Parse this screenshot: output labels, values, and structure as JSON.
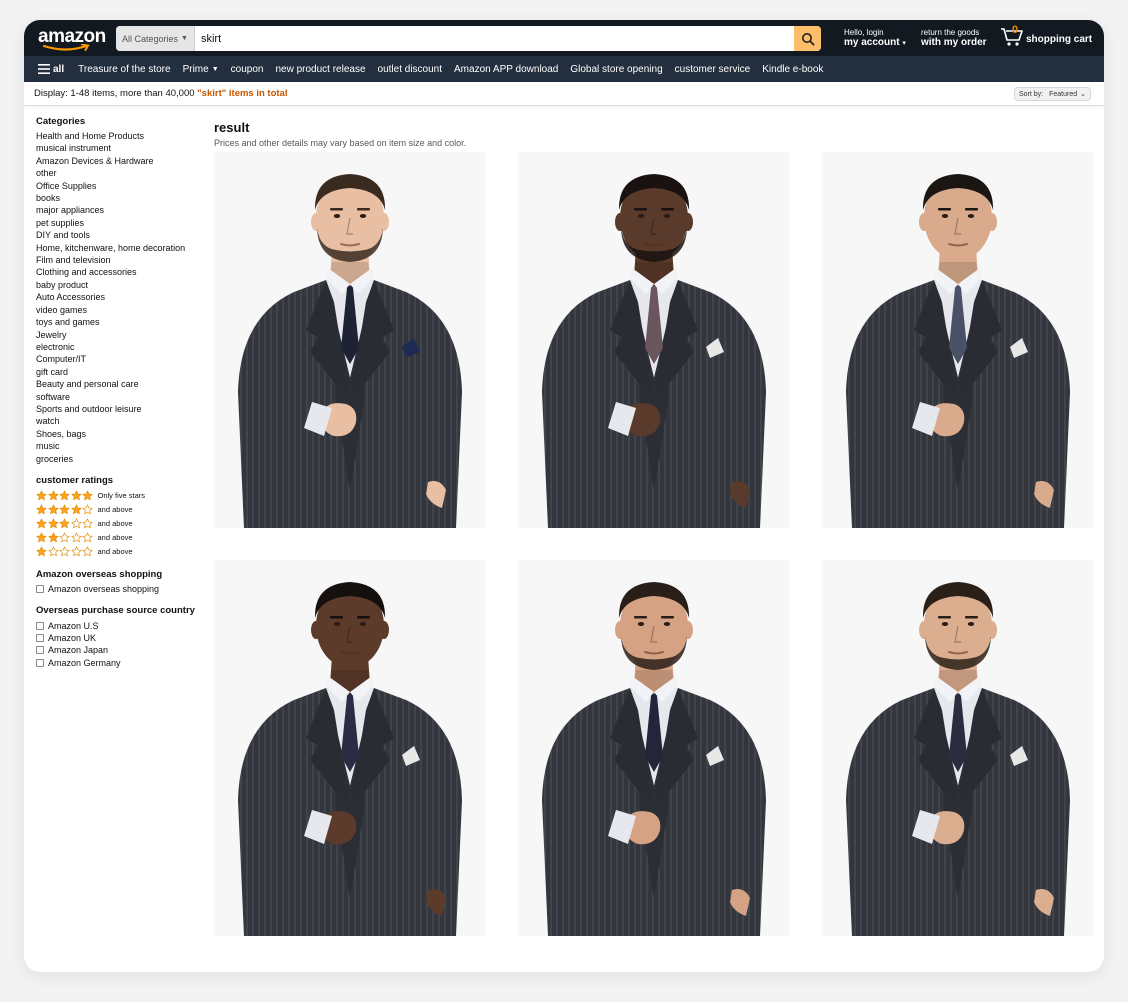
{
  "header": {
    "logo": "amazon",
    "search_category": "All Categories",
    "search_value": "skirt",
    "account_greeting": "Hello, login",
    "account_label": "my account",
    "orders_small": "return the goods",
    "orders_label": "with my order",
    "cart_count": "0",
    "cart_label": "shopping cart"
  },
  "nav": {
    "all": "all",
    "items": [
      "Treasure of the store",
      "Prime",
      "coupon",
      "new product release",
      "outlet discount",
      "Amazon APP download",
      "Global store opening",
      "customer service",
      "Kindle e-book"
    ]
  },
  "results": {
    "prefix": "Display: 1-48 items, more than 40,000 ",
    "query": "\"skirt\" items in total",
    "sort_label": "Sort by:",
    "sort_value": "Featured"
  },
  "sidebar": {
    "categories_title": "Categories",
    "categories": [
      "Health and Home Products",
      "musical instrument",
      "Amazon Devices & Hardware",
      "other",
      "Office Supplies",
      "books",
      "major appliances",
      "pet supplies",
      "DIY and tools",
      "Home, kitchenware, home decoration",
      "Film and television",
      "Clothing and accessories",
      "baby product",
      "Auto Accessories",
      "video games",
      "toys and games",
      "Jewelry",
      "electronic",
      "Computer/IT",
      "gift card",
      "Beauty and personal care",
      "software",
      "Sports and outdoor leisure",
      "watch",
      "Shoes, bags",
      "music",
      "groceries"
    ],
    "ratings_title": "customer ratings",
    "ratings": [
      {
        "stars": 5,
        "label": "Only five stars"
      },
      {
        "stars": 4,
        "label": "and above"
      },
      {
        "stars": 3,
        "label": "and above"
      },
      {
        "stars": 2,
        "label": "and above"
      },
      {
        "stars": 1,
        "label": "and above"
      }
    ],
    "overseas_title": "Amazon overseas shopping",
    "overseas_option": "Amazon overseas shopping",
    "source_title": "Overseas purchase source country",
    "sources": [
      "Amazon U.S",
      "Amazon UK",
      "Amazon Japan",
      "Amazon Germany"
    ]
  },
  "main": {
    "title": "result",
    "subtitle": "Prices and other details may vary based on item size and color.",
    "products": [
      {
        "skin": "#e8bfa3",
        "hair": "#3a2a20",
        "beard": true,
        "tie": "#1e2235",
        "square": "#1f2a55"
      },
      {
        "skin": "#5a3a2a",
        "hair": "#1a1210",
        "beard": true,
        "tie": "#6b5660",
        "square": "#e8e8e8"
      },
      {
        "skin": "#d9ab8c",
        "hair": "#1c1612",
        "beard": false,
        "tie": "#4a5066",
        "square": "#e8e8e8"
      },
      {
        "skin": "#5c3b2b",
        "hair": "#15100d",
        "beard": false,
        "tie": "#2a2c44",
        "square": "#e8e8e8"
      },
      {
        "skin": "#d6a284",
        "hair": "#2a1f18",
        "beard": true,
        "tie": "#23253a",
        "square": "#e8e8e8"
      },
      {
        "skin": "#dcae90",
        "hair": "#2b2018",
        "beard": true,
        "tie": "#2a2d40",
        "square": "#e8e8e8"
      }
    ]
  },
  "colors": {
    "nav_dark": "#131921",
    "nav_sub": "#232f3e",
    "accent": "#febd69",
    "query": "#c45500",
    "star": "#ffa41c"
  }
}
